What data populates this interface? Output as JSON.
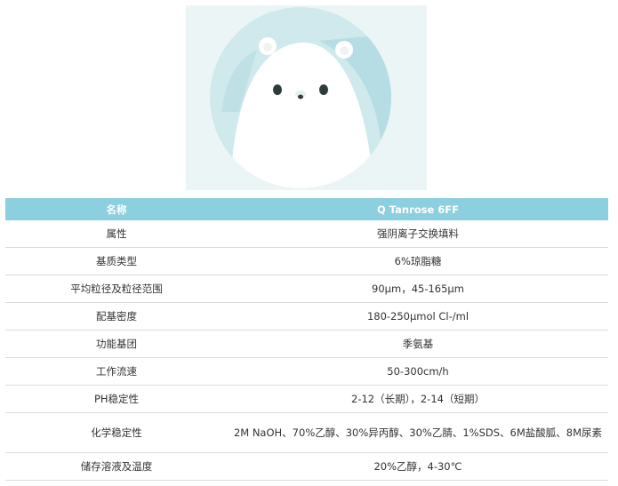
{
  "table": {
    "headers": [
      "名称",
      "Q Tanrose 6FF"
    ],
    "rows": [
      [
        "属性",
        "强阴离子交换填料"
      ],
      [
        "基质类型",
        "6%琼脂糖"
      ],
      [
        "平均粒径及粒径范围",
        "90μm，45-165μm"
      ],
      [
        "配基密度",
        "180-250μmol Cl-/ml"
      ],
      [
        "功能基团",
        "季氨基"
      ],
      [
        "工作流速",
        "50-300cm/h"
      ],
      [
        "PH稳定性",
        "2-12（长期），2-14（短期）"
      ],
      [
        "化学稳定性",
        "2M NaOH、70%乙醇、30%异丙醇、30%乙腈、1%SDS、6M盐酸胍、8M尿素"
      ],
      [
        "储存溶液及温度",
        "20%乙醇，4-30℃"
      ]
    ]
  },
  "colors": {
    "header_bg": "#8ccfde",
    "header_text": "#ffffff",
    "image_bg": "#ebf5f6",
    "circle": "#cfe9ec",
    "row_border": "#d9dcdf"
  }
}
